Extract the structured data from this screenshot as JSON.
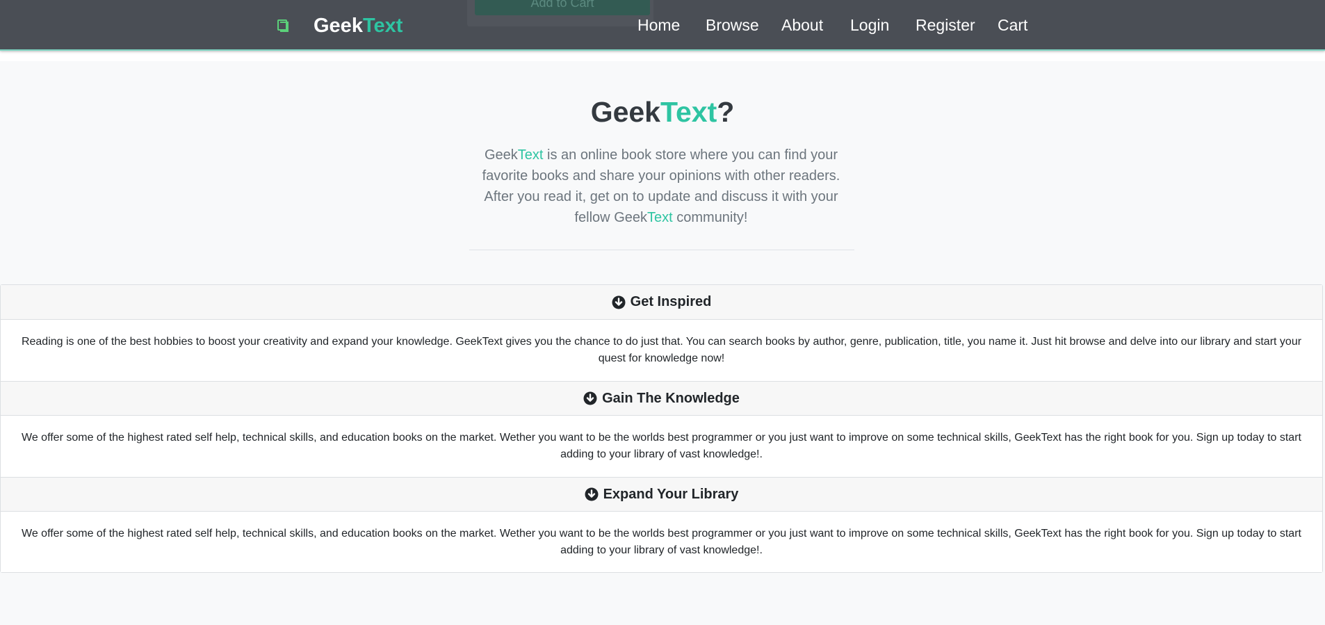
{
  "navbar": {
    "brand_geek": "Geek",
    "brand_text": "Text",
    "brand_icon": "book-icon",
    "hidden_button_label": "Add to Cart",
    "links": [
      "Home",
      "Browse",
      "About",
      "Login",
      "Register",
      "Cart"
    ]
  },
  "hero": {
    "title_geek": "Geek",
    "title_text": "Text",
    "title_q": "?",
    "desc_1": "Geek",
    "desc_2": "Text",
    "desc_3": " is an online book store where you can find your favorite books and share your opinions with other readers. After you read it, get on to update and discuss it with your fellow ",
    "desc_4": "Geek",
    "desc_5": "Text",
    "desc_6": " community!"
  },
  "accordion": {
    "items": [
      {
        "title": "Get Inspired",
        "body": "Reading is one of the best hobbies to boost your creativity and expand your knowledge. GeekText gives you the chance to do just that. You can search books by author, genre, publication, title, you name it. Just hit browse and delve into our library and start your quest for knowledge now!"
      },
      {
        "title": "Gain The Knowledge",
        "body": "We offer some of the highest rated self help, technical skills, and education books on the market. Wether you want to be the worlds best programmer or you just want to improve on some technical skills, GeekText has the right book for you. Sign up today to start adding to your library of vast knowledge!."
      },
      {
        "title": "Expand Your Library",
        "body": "We offer some of the highest rated self help, technical skills, and education books on the market. Wether you want to be the worlds best programmer or you just want to improve on some technical skills, GeekText has the right book for you. Sign up today to start adding to your library of vast knowledge!."
      }
    ]
  },
  "colors": {
    "navbar_bg": "#4a4e55",
    "accent": "#2ec4a2",
    "page_bg": "#f8f9fa"
  }
}
